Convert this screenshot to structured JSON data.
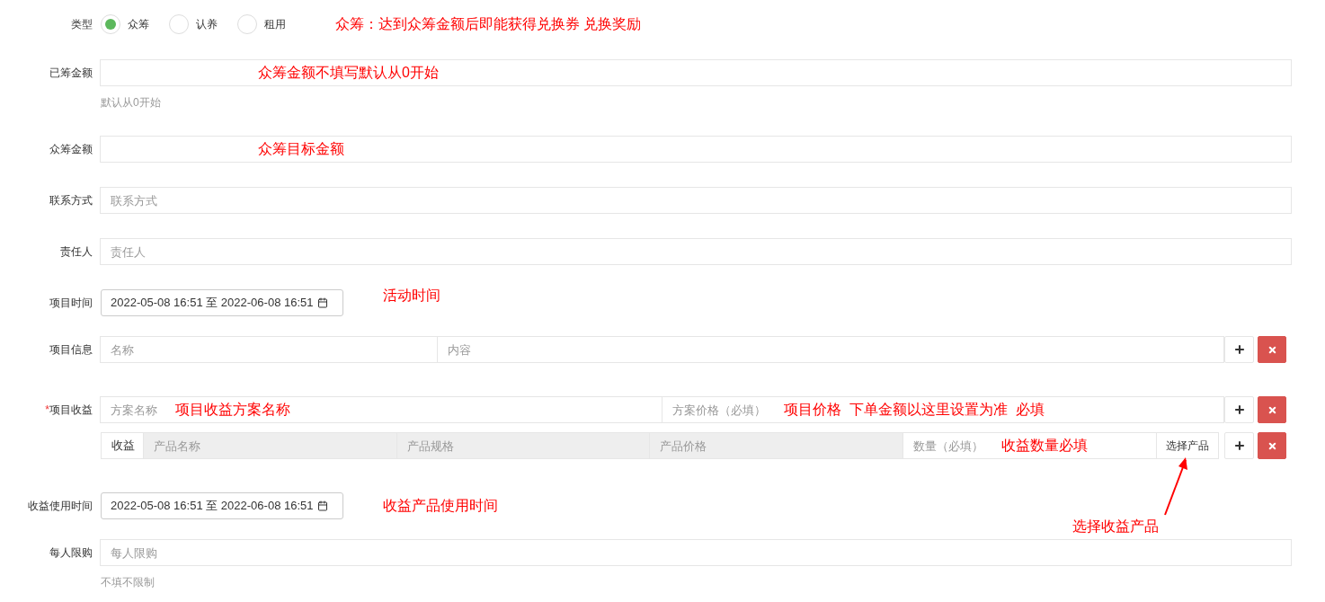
{
  "rows": [
    {
      "kind": "radio",
      "label": "类型",
      "options": [
        {
          "label": "众筹",
          "selected": true
        },
        {
          "label": "认养",
          "selected": false
        },
        {
          "label": "租用",
          "selected": false
        }
      ],
      "note": "众筹：达到众筹金额后即能获得兑换券 兑换奖励"
    },
    {
      "kind": "input",
      "label": "已筹金额",
      "note": "众筹金额不填写默认从0开始",
      "hint": "默认从0开始"
    },
    {
      "kind": "input",
      "label": "众筹金额",
      "note": "众筹目标金额"
    },
    {
      "kind": "input",
      "label": "联系方式",
      "placeholder": "联系方式"
    },
    {
      "kind": "input",
      "label": "责任人",
      "placeholder": "责任人"
    },
    {
      "kind": "daterange",
      "label": "项目时间",
      "value": "2022-05-08 16:51 至 2022-06-08 16:51",
      "note": "活动时间"
    },
    {
      "kind": "pair",
      "label": "项目信息",
      "fields": [
        {
          "placeholder": "名称"
        },
        {
          "placeholder": "内容"
        }
      ]
    },
    {
      "kind": "income",
      "label": "项目收益",
      "required_mark": "*",
      "fields": [
        {
          "placeholder": "方案名称",
          "note": "项目收益方案名称"
        },
        {
          "placeholder": "方案价格（必填）",
          "note": "项目价格  下单金额以这里设置为准  必填"
        }
      ],
      "products": {
        "tab": "收益",
        "fields": [
          {
            "placeholder": "产品名称",
            "disabled": true
          },
          {
            "placeholder": "产品规格",
            "disabled": true
          },
          {
            "placeholder": "产品价格",
            "disabled": true
          },
          {
            "placeholder": "数量（必填）",
            "disabled": false,
            "note": "收益数量必填"
          }
        ],
        "choose": {
          "label": "选择产品",
          "note": "选择收益产品"
        }
      }
    },
    {
      "kind": "daterange",
      "label": "收益使用时间",
      "value": "2022-05-08 16:51 至 2022-06-08 16:51",
      "note": "收益产品使用时间"
    },
    {
      "kind": "input",
      "label": "每人限购",
      "placeholder": "每人限购",
      "hint": "不填不限制"
    }
  ]
}
